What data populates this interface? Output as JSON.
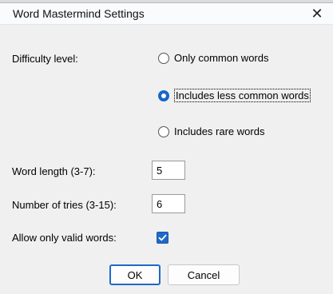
{
  "window": {
    "title": "Word Mastermind Settings"
  },
  "difficulty": {
    "label": "Difficulty level:",
    "options": [
      {
        "label": "Only common words",
        "selected": false
      },
      {
        "label": "Includes less common words",
        "selected": true
      },
      {
        "label": "Includes rare words",
        "selected": false
      }
    ]
  },
  "word_length": {
    "label": "Word length (3-7):",
    "value": "5"
  },
  "tries": {
    "label": "Number of tries (3-15):",
    "value": "6"
  },
  "valid_words": {
    "label": "Allow only valid words:",
    "checked": true
  },
  "buttons": {
    "ok": "OK",
    "cancel": "Cancel"
  },
  "icons": {
    "close": "close-icon",
    "check": "checkmark-icon"
  },
  "colors": {
    "accent": "#1f68c8"
  }
}
